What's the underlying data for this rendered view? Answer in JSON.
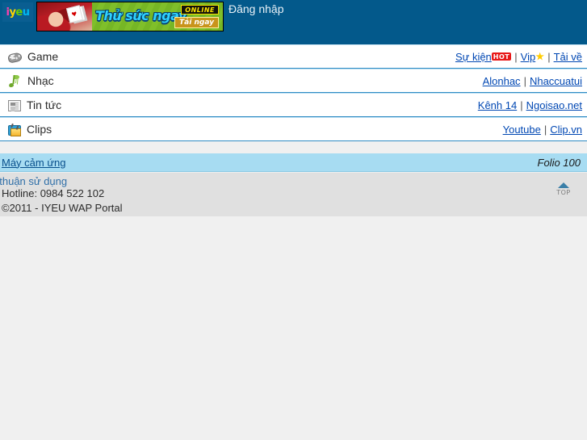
{
  "header": {
    "logo_letters": [
      "i",
      "y",
      "e",
      "u"
    ],
    "banner": {
      "title": "Thử sức ngay",
      "badge_online": "ONLINE",
      "badge_download": "Tải ngay",
      "icon": "playing-cards-icon"
    },
    "login_label": "Đăng nhập",
    "background_color": "#03598b"
  },
  "menu": {
    "rows": [
      {
        "icon": "gamepad-icon",
        "label": "Game",
        "links": [
          {
            "text": "Sự kiện",
            "badge": "HOT"
          },
          {
            "text": "Vip",
            "badge_icon": "star-icon"
          },
          {
            "text": "Tải về"
          }
        ],
        "separator": "|"
      },
      {
        "icon": "music-note-icon",
        "label": "Nhạc",
        "links": [
          {
            "text": "Alonhac"
          },
          {
            "text": "Nhaccuatui"
          }
        ],
        "separator": "|"
      },
      {
        "icon": "newspaper-icon",
        "label": "Tin tức",
        "links": [
          {
            "text": "Kênh 14"
          },
          {
            "text": "Ngoisao.net"
          }
        ],
        "separator": "|"
      },
      {
        "icon": "tv-icon",
        "label": "Clips",
        "links": [
          {
            "text": "Youtube"
          },
          {
            "text": "Clip.vn"
          }
        ],
        "separator": "|"
      }
    ]
  },
  "device_bar": {
    "link_label": "Máy cảm ứng",
    "device_model": "Folio 100",
    "background_color": "#a7dcf2"
  },
  "footer": {
    "terms_label": "Thỏa thuận sử dụng",
    "hotline": "Hotline: 0984 522 102",
    "copyright": "©2011 - IYEU WAP Portal",
    "top_button_label": "TOP",
    "background_color": "#e0e0e0"
  }
}
